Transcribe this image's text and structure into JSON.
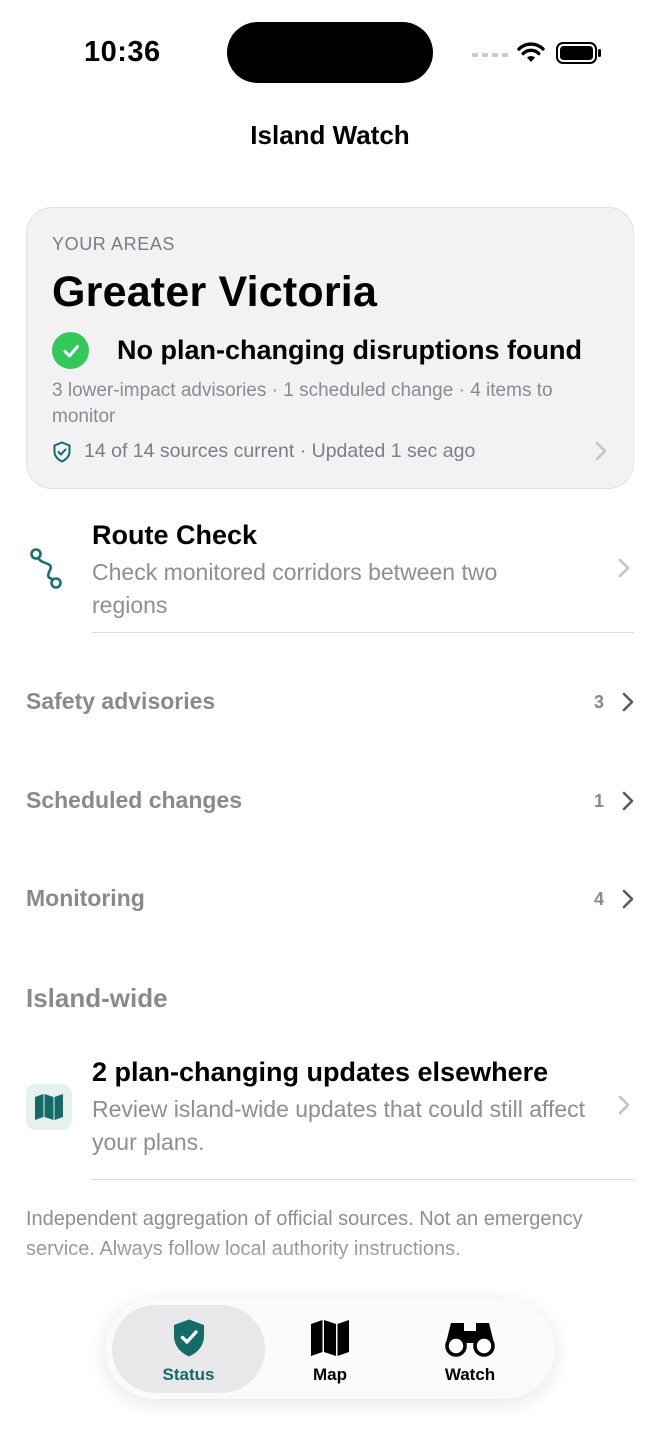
{
  "status_bar": {
    "time": "10:36"
  },
  "nav": {
    "title": "Island Watch"
  },
  "area_card": {
    "eyebrow": "YOUR AREAS",
    "area_name": "Greater Victoria",
    "status_headline": "No plan-changing disruptions found",
    "summary": "3 lower-impact advisories · 1 scheduled change · 4 items to monitor",
    "sources": "14 of 14 sources current · Updated 1 sec ago",
    "status_icon": "check-circle-icon",
    "accent_color": "#34c759"
  },
  "route_check": {
    "title": "Route Check",
    "subtitle": "Check monitored corridors between two regions",
    "icon": "route-icon"
  },
  "sections": [
    {
      "label": "Safety advisories",
      "count": "3"
    },
    {
      "label": "Scheduled changes",
      "count": "1"
    },
    {
      "label": "Monitoring",
      "count": "4"
    }
  ],
  "island_wide": {
    "heading": "Island-wide",
    "title": "2 plan-changing updates elsewhere",
    "subtitle": "Review island-wide updates that could still affect your plans.",
    "icon": "map-icon"
  },
  "disclaimer": "Independent aggregation of official sources. Not an emergency service. Always follow local authority instructions.",
  "tab_bar": {
    "selected": "Status",
    "tabs": [
      {
        "label": "Status",
        "icon": "shield-check-icon"
      },
      {
        "label": "Map",
        "icon": "map-icon"
      },
      {
        "label": "Watch",
        "icon": "binoculars-icon"
      }
    ]
  },
  "colors": {
    "brand_teal": "#146b68",
    "success_green": "#34c759"
  }
}
